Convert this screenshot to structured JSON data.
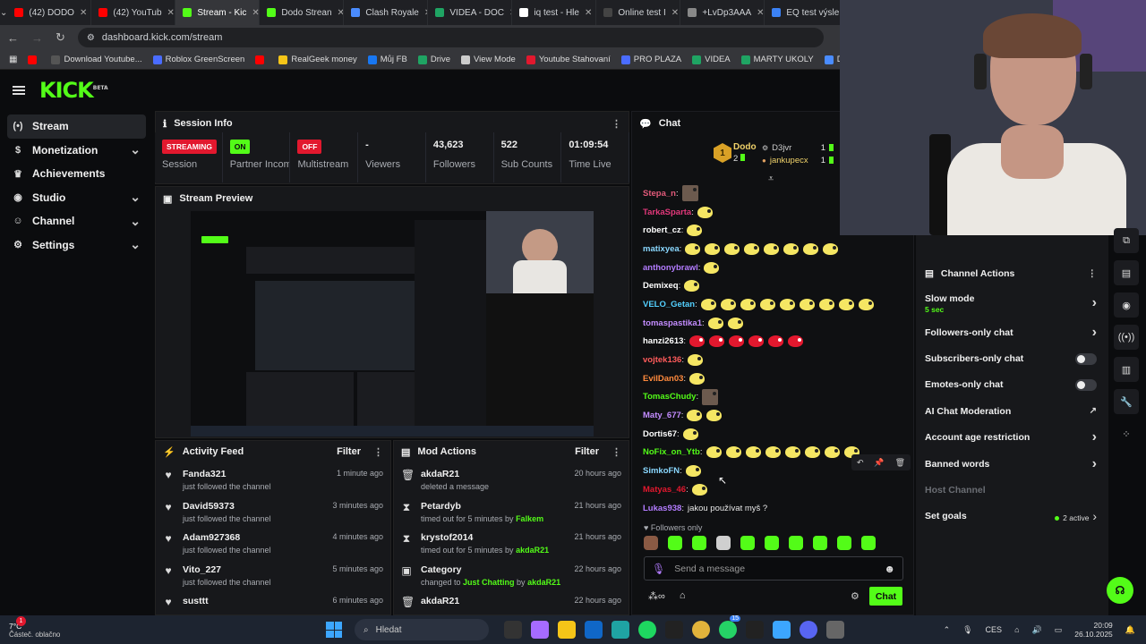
{
  "browser": {
    "tabs": [
      {
        "label": "(42) DODO",
        "color": "#ff0000"
      },
      {
        "label": "(42) YouTub",
        "color": "#ff0000"
      },
      {
        "label": "Stream - Kic",
        "color": "#53fc18",
        "active": true
      },
      {
        "label": "Dodo Strean",
        "color": "#53fc18"
      },
      {
        "label": "Clash Royale",
        "color": "#4a8cff"
      },
      {
        "label": "VIDEA - DOC",
        "color": "#1fa463"
      },
      {
        "label": "iq test - Hle",
        "color": "#ffffff"
      },
      {
        "label": "Online test I",
        "color": "#444444"
      },
      {
        "label": "+LvDp3AAA",
        "color": "#888888"
      },
      {
        "label": "EQ test výsle",
        "color": "#3b82f6"
      }
    ],
    "url": "dashboard.kick.com/stream",
    "bookmarks": [
      {
        "label": "",
        "color": "#ff0000"
      },
      {
        "label": "Download Youtube...",
        "color": "#555555"
      },
      {
        "label": "Roblox GreenScreen",
        "color": "#4a6cff"
      },
      {
        "label": "",
        "color": "#ff0000"
      },
      {
        "label": "RealGeek money",
        "color": "#f5c518"
      },
      {
        "label": "Můj FB",
        "color": "#1877f2"
      },
      {
        "label": "Drive",
        "color": "#1fa463"
      },
      {
        "label": "View Mode",
        "color": "#cccccc"
      },
      {
        "label": "Youtube Stahovaní",
        "color": "#e2182e"
      },
      {
        "label": "PRO PLAZA",
        "color": "#4a6cff"
      },
      {
        "label": "VIDEA",
        "color": "#1fa463"
      },
      {
        "label": "MARTY UKOLY",
        "color": "#1fa463"
      },
      {
        "label": "Dodo videa",
        "color": "#4a8cff"
      }
    ]
  },
  "kick": {
    "logo": "KICK",
    "logo_sup": "BETA",
    "sidebar": [
      {
        "label": "Stream",
        "icon": "broadcast-icon",
        "active": true,
        "chev": false
      },
      {
        "label": "Monetization",
        "icon": "dollar-icon",
        "chev": true
      },
      {
        "label": "Achievements",
        "icon": "trophy-icon",
        "chev": false
      },
      {
        "label": "Studio",
        "icon": "camera-icon",
        "chev": true
      },
      {
        "label": "Channel",
        "icon": "user-icon",
        "chev": true
      },
      {
        "label": "Settings",
        "icon": "gear-icon",
        "chev": true
      }
    ],
    "session": {
      "title": "Session Info",
      "stats": [
        {
          "value": "",
          "badge": "STREAMING",
          "badge_type": "red",
          "label": "Session"
        },
        {
          "value": "",
          "badge": "ON",
          "badge_type": "green",
          "label": "Partner Income"
        },
        {
          "value": "",
          "badge": "OFF",
          "badge_type": "red",
          "label": "Multistream"
        },
        {
          "value": "-",
          "label": "Viewers"
        },
        {
          "value": "43,623",
          "label": "Followers"
        },
        {
          "value": "522",
          "label": "Sub Counts"
        },
        {
          "value": "01:09:54",
          "label": "Time Live"
        }
      ]
    },
    "preview_title": "Stream Preview",
    "activity": {
      "title": "Activity Feed",
      "filter": "Filter",
      "rows": [
        {
          "name": "Fanda321",
          "desc": "just followed the channel",
          "time": "1 minute ago"
        },
        {
          "name": "David59373",
          "desc": "just followed the channel",
          "time": "3 minutes ago"
        },
        {
          "name": "Adam927368",
          "desc": "just followed the channel",
          "time": "4 minutes ago"
        },
        {
          "name": "Vito_227",
          "desc": "just followed the channel",
          "time": "5 minutes ago"
        },
        {
          "name": "susttt",
          "desc": "",
          "time": "6 minutes ago"
        }
      ]
    },
    "mod": {
      "title": "Mod Actions",
      "filter": "Filter",
      "rows": [
        {
          "name": "akdaR21",
          "icon": "trash-icon",
          "pre": "deleted a message",
          "hl": "",
          "mid": "",
          "hl2": "",
          "time": "20 hours ago"
        },
        {
          "name": "Petardyb",
          "icon": "hourglass-icon",
          "pre": "timed out for 5 minutes by ",
          "hl": "Falkem",
          "mid": "",
          "hl2": "",
          "time": "21 hours ago"
        },
        {
          "name": "krystof2014",
          "icon": "hourglass-icon",
          "pre": "timed out for 5 minutes by ",
          "hl": "akdaR21",
          "mid": "",
          "hl2": "",
          "time": "21 hours ago"
        },
        {
          "name": "Category",
          "icon": "calendar-icon",
          "pre": "changed to ",
          "hl": "Just Chatting",
          "mid": " by ",
          "hl2": "akdaR21",
          "time": "22 hours ago"
        },
        {
          "name": "akdaR21",
          "icon": "trash-icon",
          "pre": "",
          "hl": "",
          "mid": "",
          "hl2": "",
          "time": "22 hours ago"
        }
      ]
    },
    "chat": {
      "title": "Chat",
      "leaderboard": {
        "rank": "1",
        "name": "Dodo",
        "count": "2",
        "users": [
          {
            "name": "D3jvr",
            "count": "1"
          },
          {
            "name": "jankupecx",
            "count": "1"
          }
        ]
      },
      "messages": [
        {
          "user": "Stepa_n",
          "color": "#e25a7a",
          "emotes": [
            {
              "t": "pic",
              "n": 1
            }
          ]
        },
        {
          "user": "TarkaSparta",
          "color": "#e2387a",
          "emotes": [
            {
              "t": "y",
              "n": 1
            }
          ]
        },
        {
          "user": "robert_cz",
          "color": "#ffffff",
          "emotes": [
            {
              "t": "y",
              "n": 1
            }
          ]
        },
        {
          "user": "matixyea",
          "color": "#8ad8ff",
          "emotes": [
            {
              "t": "y",
              "n": 8
            }
          ]
        },
        {
          "user": "anthonybrawl",
          "color": "#b37cff",
          "emotes": [
            {
              "t": "y",
              "n": 1
            }
          ]
        },
        {
          "user": "Demixeq",
          "color": "#ffffff",
          "emotes": [
            {
              "t": "y",
              "n": 1
            }
          ]
        },
        {
          "user": "VELO_Getan",
          "color": "#53d0ff",
          "emotes": [
            {
              "t": "y",
              "n": 9
            }
          ]
        },
        {
          "user": "tomaspastika1",
          "color": "#c38cff",
          "emotes": [
            {
              "t": "y",
              "n": 2
            }
          ]
        },
        {
          "user": "hanzi2613",
          "color": "#ffffff",
          "emotes": [
            {
              "t": "red",
              "n": 6
            }
          ]
        },
        {
          "user": "vojtek136",
          "color": "#ff5b5b",
          "emotes": [
            {
              "t": "y",
              "n": 1
            }
          ]
        },
        {
          "user": "EvilDan03",
          "color": "#ff8a3d",
          "emotes": [
            {
              "t": "y",
              "n": 1
            }
          ]
        },
        {
          "user": "TomasChudy",
          "color": "#53fc18",
          "emotes": [
            {
              "t": "pic",
              "n": 1
            }
          ]
        },
        {
          "user": "Maty_677",
          "color": "#c38cff",
          "emotes": [
            {
              "t": "y",
              "n": 2
            }
          ]
        },
        {
          "user": "Dortis67",
          "color": "#ffffff",
          "emotes": [
            {
              "t": "y",
              "n": 1
            }
          ]
        },
        {
          "user": "NoFix_on_Ytb",
          "color": "#53fc18",
          "emotes": [
            {
              "t": "y",
              "n": 8
            }
          ]
        },
        {
          "user": "SimkoFN",
          "color": "#8ad8ff",
          "emotes": [
            {
              "t": "y",
              "n": 1
            }
          ]
        },
        {
          "user": "Matyas_46",
          "color": "#e2182e",
          "emotes": [
            {
              "t": "y",
              "n": 1
            }
          ]
        },
        {
          "user": "Lukas938",
          "color": "#b37cff",
          "text": "jakou používat myš ?",
          "emotes": []
        }
      ],
      "followers_only": "Followers only",
      "placeholder": "Send a message",
      "send": "Chat"
    },
    "actions": {
      "title": "Channel Actions",
      "rows": [
        {
          "label": "Slow mode",
          "sub": "5 sec",
          "kind": "chev"
        },
        {
          "label": "Followers-only chat",
          "kind": "chev"
        },
        {
          "label": "Subscribers-only chat",
          "kind": "toggle"
        },
        {
          "label": "Emotes-only chat",
          "kind": "toggle"
        },
        {
          "label": "AI Chat Moderation",
          "kind": "ext"
        },
        {
          "label": "Account age restriction",
          "kind": "chev"
        },
        {
          "label": "Banned words",
          "kind": "chev"
        },
        {
          "label": "Host Channel",
          "kind": "disabled"
        },
        {
          "label": "Set goals",
          "kind": "goals",
          "extra": "2 active"
        }
      ]
    }
  },
  "taskbar": {
    "weather_temp": "7°C",
    "weather_desc": "Částeč. oblačno",
    "weather_badge": "1",
    "search": "Hledat",
    "lang": "CES",
    "time": "20:09",
    "date": "26.10.2025",
    "badge": "15"
  }
}
